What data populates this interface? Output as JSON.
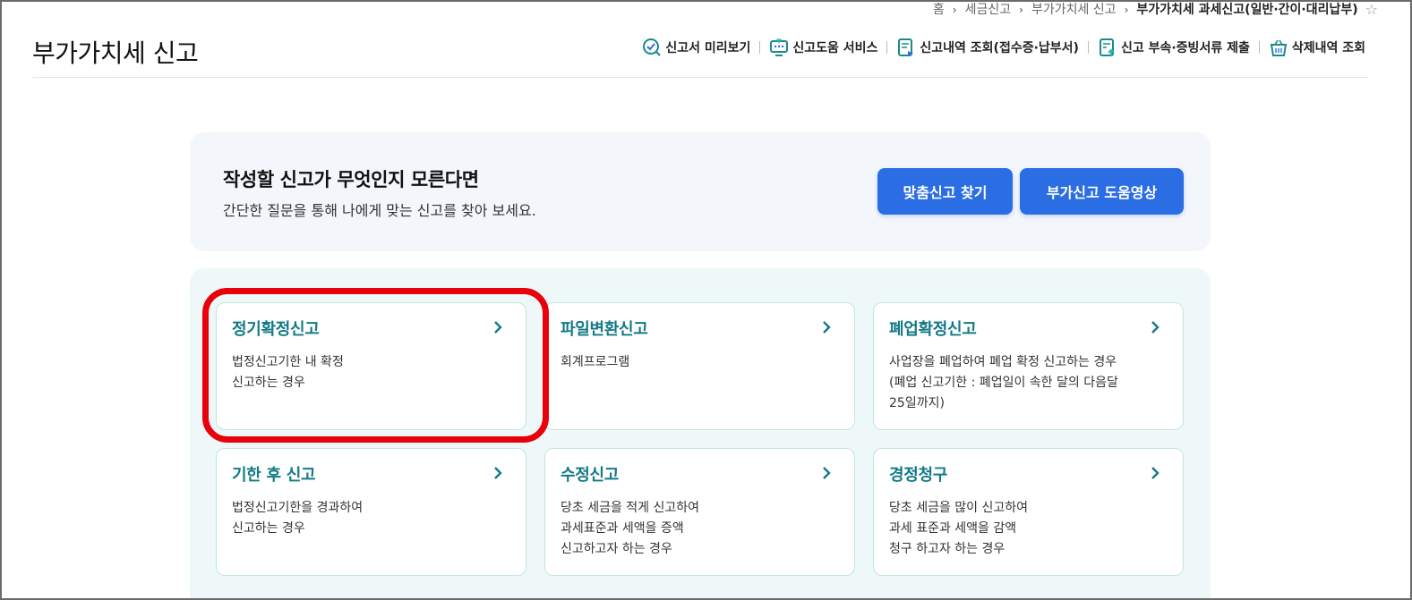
{
  "breadcrumb": {
    "items": [
      "홈",
      "세금신고",
      "부가가치세 신고",
      "부가가치세 과세신고(일반·간이·대리납부)"
    ],
    "separator": "›",
    "star": "☆"
  },
  "page_title": "부가가치세 신고",
  "toolbar": {
    "items": [
      {
        "label": "신고서 미리보기",
        "icon": "preview-check-icon"
      },
      {
        "label": "신고도움 서비스",
        "icon": "help-service-monitor-icon"
      },
      {
        "label": "신고내역 조회(접수증·납부서)",
        "icon": "history-document-icon"
      },
      {
        "label": "신고 부속·증빙서류 제출",
        "icon": "upload-document-icon"
      },
      {
        "label": "삭제내역 조회",
        "icon": "trash-basket-icon"
      }
    ]
  },
  "guide": {
    "heading": "작성할 신고가 무엇인지 모른다면",
    "subtext": "간단한 질문을 통해 나에게 맞는 신고를 찾아 보세요.",
    "find_button": "맞춤신고 찾기",
    "video_button": "부가신고 도움영상"
  },
  "cards": [
    {
      "title": "정기확정신고",
      "desc": "법정신고기한 내 확정\n신고하는 경우"
    },
    {
      "title": "파일변환신고",
      "desc": "회계프로그램"
    },
    {
      "title": "폐업확정신고",
      "desc": "사업장을 폐업하여 폐업 확정 신고하는 경우\n(폐업 신고기한 : 폐업일이 속한 달의 다음달\n25일까지)"
    },
    {
      "title": "기한 후 신고",
      "desc": "법정신고기한을 경과하여\n신고하는 경우"
    },
    {
      "title": "수정신고",
      "desc": "당초 세금을 적게 신고하여\n과세표준과 세액을 증액\n신고하고자 하는 경우"
    },
    {
      "title": "경정청구",
      "desc": "당초 세금을 많이 신고하여\n과세 표준과 세액을 감액\n청구 하고자 하는 경우"
    }
  ],
  "colors": {
    "primary_button": "#2b6de3",
    "card_title": "#137a86",
    "highlight": "#e8000b"
  }
}
